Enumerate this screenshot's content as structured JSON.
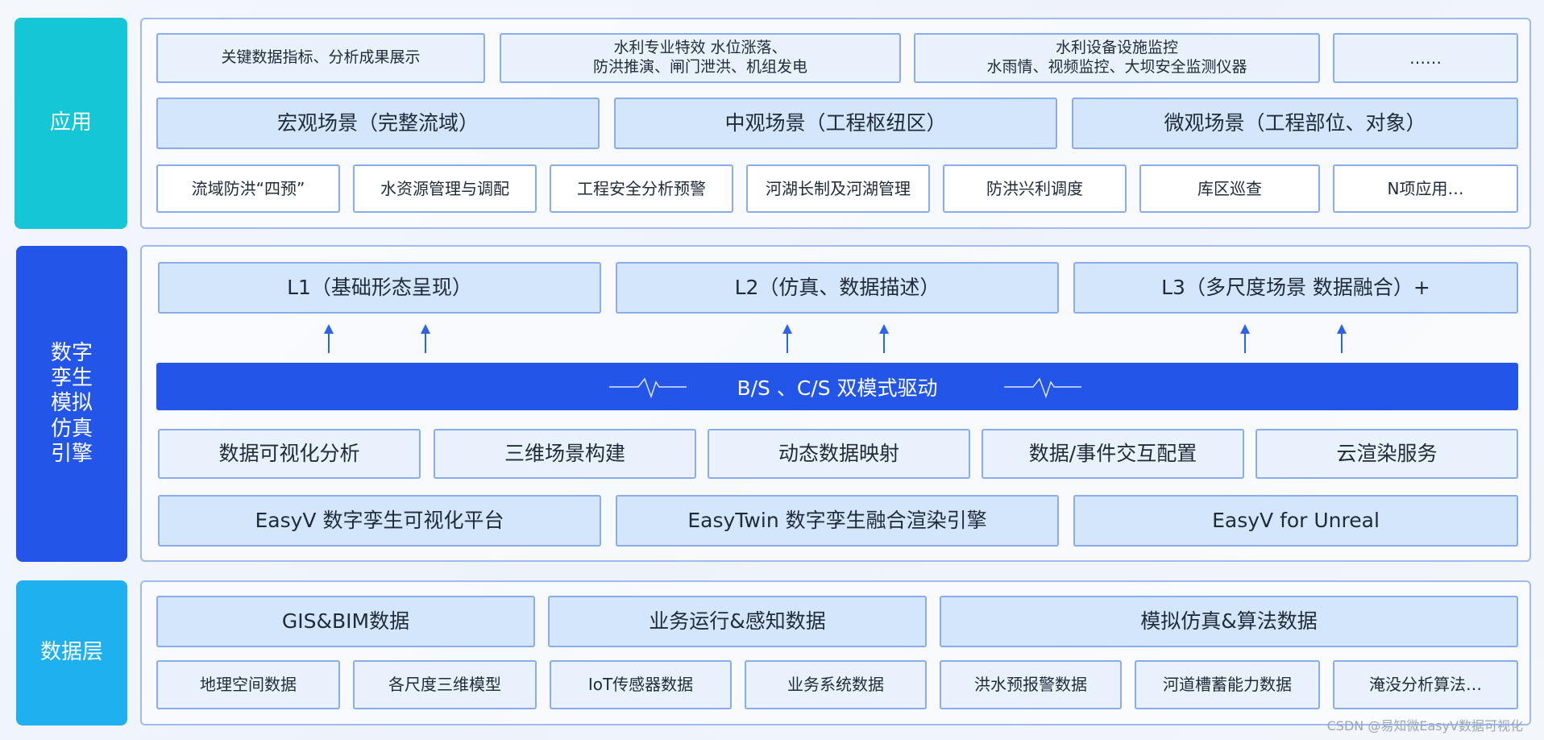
{
  "layers": {
    "app": {
      "label": "应用",
      "row1": [
        "关键数据指标、分析成果展示",
        "水利专业特效 水位涨落、\n防洪推演、闸门泄洪、机组发电",
        "水利设备设施监控\n水雨情、视频监控、大坝安全监测仪器",
        "……"
      ],
      "row2": [
        "宏观场景（完整流域）",
        "中观场景（工程枢纽区）",
        "微观场景（工程部位、对象）"
      ],
      "row3": [
        "流域防洪“四预”",
        "水资源管理与调配",
        "工程安全分析预警",
        "河湖长制及河湖管理",
        "防洪兴利调度",
        "库区巡查",
        "N项应用…"
      ]
    },
    "engine": {
      "label": "数字\n孪生\n模拟\n仿真\n引擎",
      "levels": [
        "L1（基础形态呈现）",
        "L2（仿真、数据描述）",
        "L3（多尺度场景 数据融合）+"
      ],
      "drive": "B/S 、C/S 双模式驱动",
      "capabilities": [
        "数据可视化分析",
        "三维场景构建",
        "动态数据映射",
        "数据/事件交互配置",
        "云渲染服务"
      ],
      "platforms": [
        "EasyV 数字孪生可视化平台",
        "EasyTwin 数字孪生融合渲染引擎",
        "EasyV for  Unreal"
      ]
    },
    "data": {
      "label": "数据层",
      "row1": [
        "GIS&BIM数据",
        "业务运行&感知数据",
        "模拟仿真&算法数据"
      ],
      "row2": [
        "地理空间数据",
        "各尺度三维模型",
        "IoT传感器数据",
        "业务系统数据",
        "洪水预报警数据",
        "河道槽蓄能力数据",
        "淹没分析算法…"
      ]
    }
  },
  "watermark": "CSDN @易知微EasyV数据可视化",
  "colors": {
    "app_label": "#14c6d6",
    "engine_label": "#2355e8",
    "data_label": "#1fb1ef",
    "drive_bar": "#2355e8",
    "arrow": "#2f63e6",
    "box_border": "#89aceb"
  }
}
